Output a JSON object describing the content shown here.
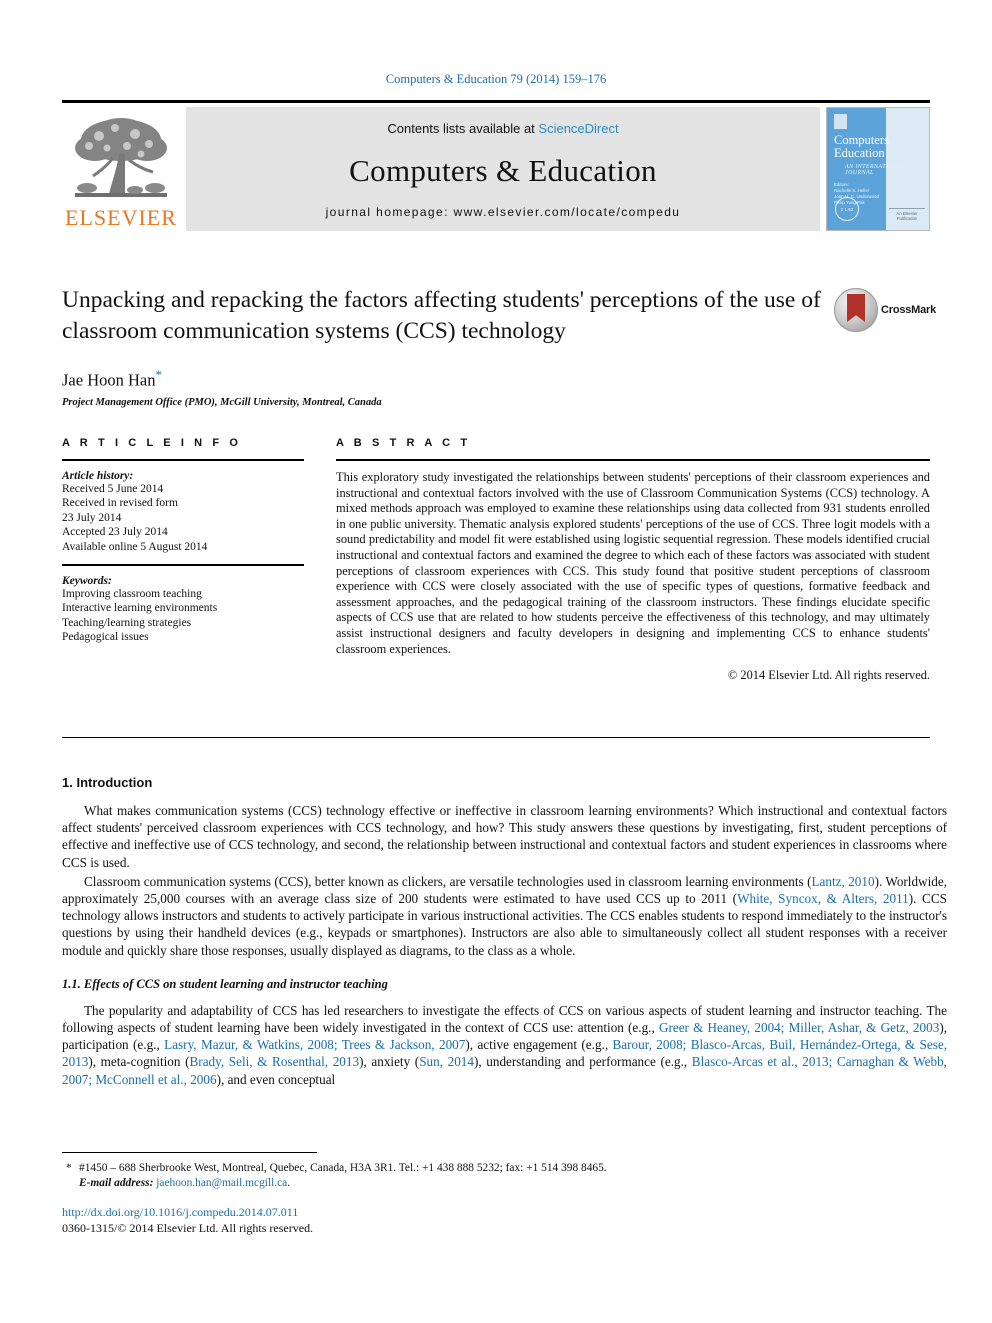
{
  "running_head": "Computers & Education 79 (2014) 159–176",
  "masthead": {
    "publisher": "ELSEVIER",
    "contents_prefix": "Contents lists available at ",
    "contents_link": "ScienceDirect",
    "journal_title": "Computers & Education",
    "homepage": "journal homepage: www.elsevier.com/locate/compedu",
    "cover": {
      "title_line1": "Computers",
      "title_amp": "&",
      "title_line2": "Education",
      "subtitle": "AN INTERNATIONAL JOURNAL",
      "editors_label": "Editors:",
      "editors": "Rachelle S. Heller\nJoan M. C. Underwood\nPhilip Yung Pak",
      "seal": "2 1.62",
      "foot": "An Elsevier\nPublication"
    }
  },
  "article": {
    "title": "Unpacking and repacking the factors affecting students' perceptions of the use of classroom communication systems (CCS) technology",
    "crossmark_label": "CrossMark",
    "author": "Jae Hoon Han",
    "author_marker": "*",
    "affiliation": "Project Management Office (PMO), McGill University, Montreal, Canada"
  },
  "article_info": {
    "heading": "A R T I C L E   I N F O",
    "history_label": "Article history:",
    "history": [
      "Received 5 June 2014",
      "Received in revised form",
      "23 July 2014",
      "Accepted 23 July 2014",
      "Available online 5 August 2014"
    ],
    "keywords_label": "Keywords:",
    "keywords": [
      "Improving classroom teaching",
      "Interactive learning environments",
      "Teaching/learning strategies",
      "Pedagogical issues"
    ]
  },
  "abstract": {
    "heading": "A B S T R A C T",
    "text": "This exploratory study investigated the relationships between students' perceptions of their classroom experiences and instructional and contextual factors involved with the use of Classroom Communication Systems (CCS) technology. A mixed methods approach was employed to examine these relationships using data collected from 931 students enrolled in one public university. Thematic analysis explored students' perceptions of the use of CCS. Three logit models with a sound predictability and model fit were established using logistic sequential regression. These models identified crucial instructional and contextual factors and examined the degree to which each of these factors was associated with student perceptions of classroom experiences with CCS. This study found that positive student perceptions of classroom experience with CCS were closely associated with the use of specific types of questions, formative feedback and assessment approaches, and the pedagogical training of the classroom instructors. These findings elucidate specific aspects of CCS use that are related to how students perceive the effectiveness of this technology, and may ultimately assist instructional designers and faculty developers in designing and implementing CCS to enhance students' classroom experiences.",
    "copyright": "© 2014 Elsevier Ltd. All rights reserved."
  },
  "body": {
    "section1_heading": "1. Introduction",
    "para1": "What makes communication systems (CCS) technology effective or ineffective in classroom learning environments? Which instructional and contextual factors affect students' perceived classroom experiences with CCS technology, and how? This study answers these questions by investigating, first, student perceptions of effective and ineffective use of CCS technology, and second, the relationship between instructional and contextual factors and student experiences in classrooms where CCS is used.",
    "para2_parts": [
      {
        "t": "Classroom communication systems (CCS), better known as clickers, are versatile technologies used in classroom learning environments (",
        "link": false
      },
      {
        "t": "Lantz, 2010",
        "link": true
      },
      {
        "t": "). Worldwide, approximately 25,000 courses with an average class size of 200 students were estimated to have used CCS up to 2011 (",
        "link": false
      },
      {
        "t": "White, Syncox, & Alters, 2011",
        "link": true
      },
      {
        "t": "). CCS technology allows instructors and students to actively participate in various instructional activities. The CCS enables students to respond immediately to the instructor's questions by using their handheld devices (e.g., keypads or smartphones). Instructors are also able to simultaneously collect all student responses with a receiver module and quickly share those responses, usually displayed as diagrams, to the class as a whole.",
        "link": false
      }
    ],
    "section11_heading": "1.1. Effects of CCS on student learning and instructor teaching",
    "para3_parts": [
      {
        "t": "The popularity and adaptability of CCS has led researchers to investigate the effects of CCS on various aspects of student learning and instructor teaching. The following aspects of student learning have been widely investigated in the context of CCS use: attention (e.g., ",
        "link": false
      },
      {
        "t": "Greer & Heaney, 2004; Miller, Ashar, & Getz, 2003",
        "link": true
      },
      {
        "t": "), participation (e.g., ",
        "link": false
      },
      {
        "t": "Lasry, Mazur, & Watkins, 2008; Trees & Jackson, 2007",
        "link": true
      },
      {
        "t": "), active engagement (e.g., ",
        "link": false
      },
      {
        "t": "Barour, 2008; Blasco-Arcas, Buil, Hernández-Ortega, & Sese, 2013",
        "link": true
      },
      {
        "t": "), meta-cognition (",
        "link": false
      },
      {
        "t": "Brady, Seli, & Rosenthal, 2013",
        "link": true
      },
      {
        "t": "), anxiety (",
        "link": false
      },
      {
        "t": "Sun, 2014",
        "link": true
      },
      {
        "t": "), understanding and performance (e.g., ",
        "link": false
      },
      {
        "t": "Blasco-Arcas et al., 2013; Carnaghan & Webb, 2007; McConnell et al., 2006",
        "link": true
      },
      {
        "t": "), and even conceptual",
        "link": false
      }
    ]
  },
  "footnotes": {
    "marker": "*",
    "address": "#1450 – 688 Sherbrooke West, Montreal, Quebec, Canada, H3A 3R1. Tel.: +1 438 888 5232; fax: +1 514 398 8465.",
    "email_label": "E-mail address:",
    "email": "jaehoon.han@mail.mcgill.ca",
    "email_suffix": "."
  },
  "footer": {
    "doi": "http://dx.doi.org/10.1016/j.compedu.2014.07.011",
    "issn": "0360-1315/© 2014 Elsevier Ltd. All rights reserved."
  },
  "colors": {
    "link": "#1b6ea8",
    "elsevier_orange": "#E87722",
    "masthead_grey": "#e3e3e3"
  }
}
